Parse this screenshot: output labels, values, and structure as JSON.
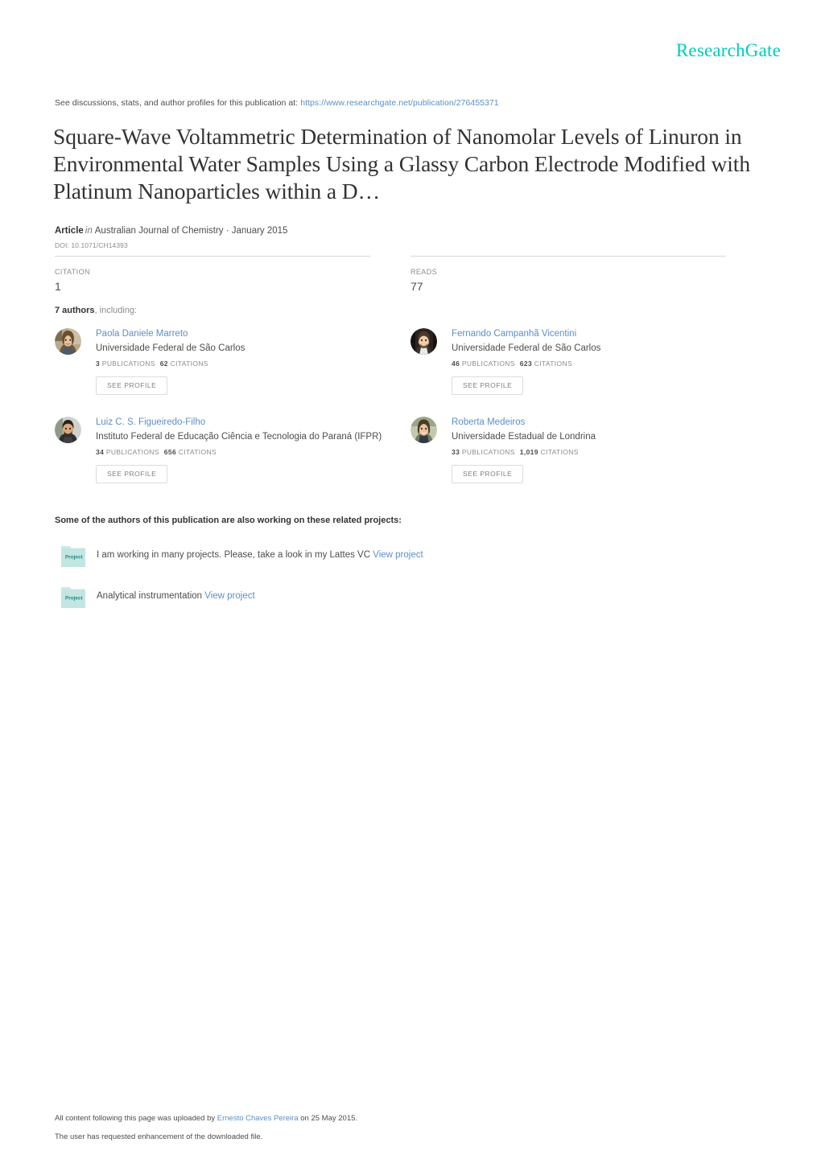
{
  "brand": {
    "name": "ResearchGate",
    "color": "#00ccbb"
  },
  "discussions": {
    "prefix": "See discussions, stats, and author profiles for this publication at:",
    "url": "https://www.researchgate.net/publication/276455371"
  },
  "publication": {
    "title": "Square-Wave Voltammetric Determination of Nanomolar Levels of Linuron in Environmental Water Samples Using a Glassy Carbon Electrode Modified with Platinum Nanoparticles within a D…",
    "type_label": "Article",
    "in_word": "in",
    "venue": "Australian Journal of Chemistry · January 2015",
    "doi": "DOI: 10.1071/CH14393"
  },
  "stats": [
    {
      "label": "CITATION",
      "value": "1"
    },
    {
      "label": "READS",
      "value": "77"
    }
  ],
  "authors_intro": {
    "count": "7 authors",
    "suffix": ", including:"
  },
  "authors": [
    {
      "name": "Paola Daniele Marreto",
      "institution": "Universidade Federal de São Carlos",
      "publications": "3",
      "publications_label": "PUBLICATIONS",
      "citations": "62",
      "citations_label": "CITATIONS",
      "button": "SEE PROFILE"
    },
    {
      "name": "Fernando Campanhã Vicentini",
      "institution": "Universidade Federal de São Carlos",
      "publications": "46",
      "publications_label": "PUBLICATIONS",
      "citations": "623",
      "citations_label": "CITATIONS",
      "button": "SEE PROFILE"
    },
    {
      "name": "Luiz C. S. Figueiredo-Filho",
      "institution": "Instituto Federal de Educação Ciência e Tecnologia do Paraná (IFPR)",
      "publications": "34",
      "publications_label": "PUBLICATIONS",
      "citations": "656",
      "citations_label": "CITATIONS",
      "button": "SEE PROFILE"
    },
    {
      "name": "Roberta Medeiros",
      "institution": "Universidade Estadual de Londrina",
      "publications": "33",
      "publications_label": "PUBLICATIONS",
      "citations": "1,019",
      "citations_label": "CITATIONS",
      "button": "SEE PROFILE"
    }
  ],
  "projects": {
    "heading": "Some of the authors of this publication are also working on these related projects:",
    "items": [
      {
        "icon_label": "Project",
        "text": "I am working in many projects. Please, take a look in my Lattes VC",
        "link": "View project"
      },
      {
        "icon_label": "Project",
        "text": "Analytical instrumentation",
        "link": "View project"
      }
    ]
  },
  "footer": {
    "line1_prefix": "All content following this page was uploaded by",
    "line1_uploader": "Ernesto Chaves Pereira",
    "line1_suffix": "on 25 May 2015.",
    "line2": "The user has requested enhancement of the downloaded file."
  }
}
